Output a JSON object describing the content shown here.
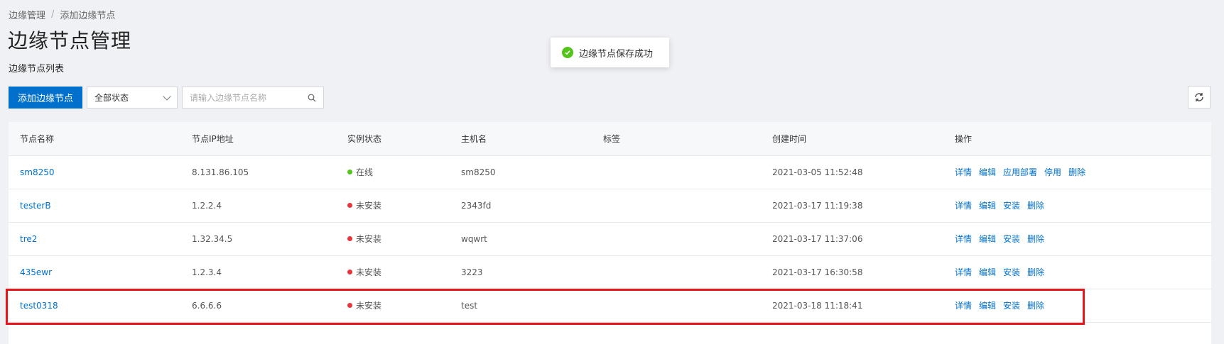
{
  "breadcrumb": {
    "root": "边缘管理",
    "separator": "/",
    "current": "添加边缘节点"
  },
  "page_title": "边缘节点管理",
  "subtitle": "边缘节点列表",
  "toolbar": {
    "add_button": "添加边缘节点",
    "status_select": "全部状态",
    "search_placeholder": "请输入边缘节点名称"
  },
  "toast": {
    "message": "边缘节点保存成功"
  },
  "colors": {
    "online": "#52c41a",
    "not_installed": "#e8353a",
    "link": "#0070cc",
    "highlight": "#e8161b"
  },
  "table": {
    "headers": [
      "节点名称",
      "节点IP地址",
      "实例状态",
      "主机名",
      "标签",
      "创建时间",
      "操作"
    ],
    "rows": [
      {
        "name": "sm8250",
        "ip": "8.131.86.105",
        "status": "在线",
        "status_type": "online",
        "host": "sm8250",
        "tag": "",
        "created": "2021-03-05 11:52:48",
        "actions": [
          "详情",
          "编辑",
          "应用部署",
          "停用",
          "删除"
        ]
      },
      {
        "name": "testerB",
        "ip": "1.2.2.4",
        "status": "未安装",
        "status_type": "not_installed",
        "host": "2343fd",
        "tag": "",
        "created": "2021-03-17 11:19:38",
        "actions": [
          "详情",
          "编辑",
          "安装",
          "删除"
        ]
      },
      {
        "name": "tre2",
        "ip": "1.32.34.5",
        "status": "未安装",
        "status_type": "not_installed",
        "host": "wqwrt",
        "tag": "",
        "created": "2021-03-17 11:37:06",
        "actions": [
          "详情",
          "编辑",
          "安装",
          "删除"
        ]
      },
      {
        "name": "435ewr",
        "ip": "1.2.3.4",
        "status": "未安装",
        "status_type": "not_installed",
        "host": "3223",
        "tag": "",
        "created": "2021-03-17 16:30:58",
        "actions": [
          "详情",
          "编辑",
          "安装",
          "删除"
        ]
      },
      {
        "name": "test0318",
        "ip": "6.6.6.6",
        "status": "未安装",
        "status_type": "not_installed",
        "host": "test",
        "tag": "",
        "created": "2021-03-18 11:18:41",
        "actions": [
          "详情",
          "编辑",
          "安装",
          "删除"
        ]
      }
    ]
  }
}
